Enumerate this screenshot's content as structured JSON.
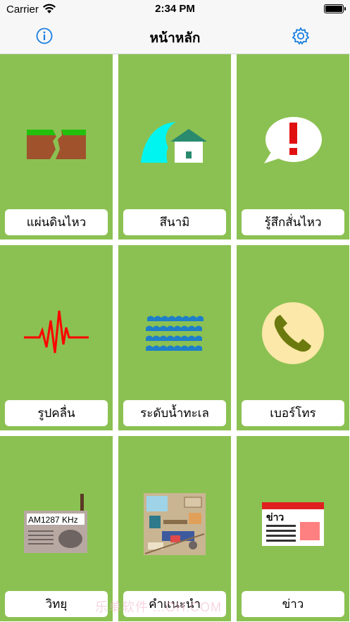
{
  "status_bar": {
    "carrier": "Carrier",
    "time": "2:34 PM",
    "wifi_icon": "wifi-icon",
    "battery_icon": "battery-icon"
  },
  "nav_bar": {
    "title": "หน้าหลัก",
    "left_icon": "info-icon",
    "right_icon": "gear-icon",
    "accent_color": "#1a7fe0"
  },
  "tiles": [
    {
      "label": "แผ่นดินไหว",
      "icon": "earthquake-icon"
    },
    {
      "label": "สึนามิ",
      "icon": "tsunami-icon"
    },
    {
      "label": "รู้สึกสั่นไหว",
      "icon": "alert-bubble-icon"
    },
    {
      "label": "รูปคลื่น",
      "icon": "waveform-icon"
    },
    {
      "label": "ระดับน้ำทะเล",
      "icon": "sea-level-icon"
    },
    {
      "label": "เบอร์โทร",
      "icon": "phone-icon"
    },
    {
      "label": "วิทยุ",
      "icon": "radio-icon"
    },
    {
      "label": "คำแนะนำ",
      "icon": "advice-room-icon"
    },
    {
      "label": "ข่าว",
      "icon": "news-icon"
    }
  ],
  "radio_display": "AM1287 KHz",
  "news_badge": "ข่าว",
  "colors": {
    "tile_bg": "#8bc152",
    "label_bg": "#ffffff",
    "grid_gap": "#ffffff"
  },
  "watermark": "乐单软件 ...OH.COM"
}
